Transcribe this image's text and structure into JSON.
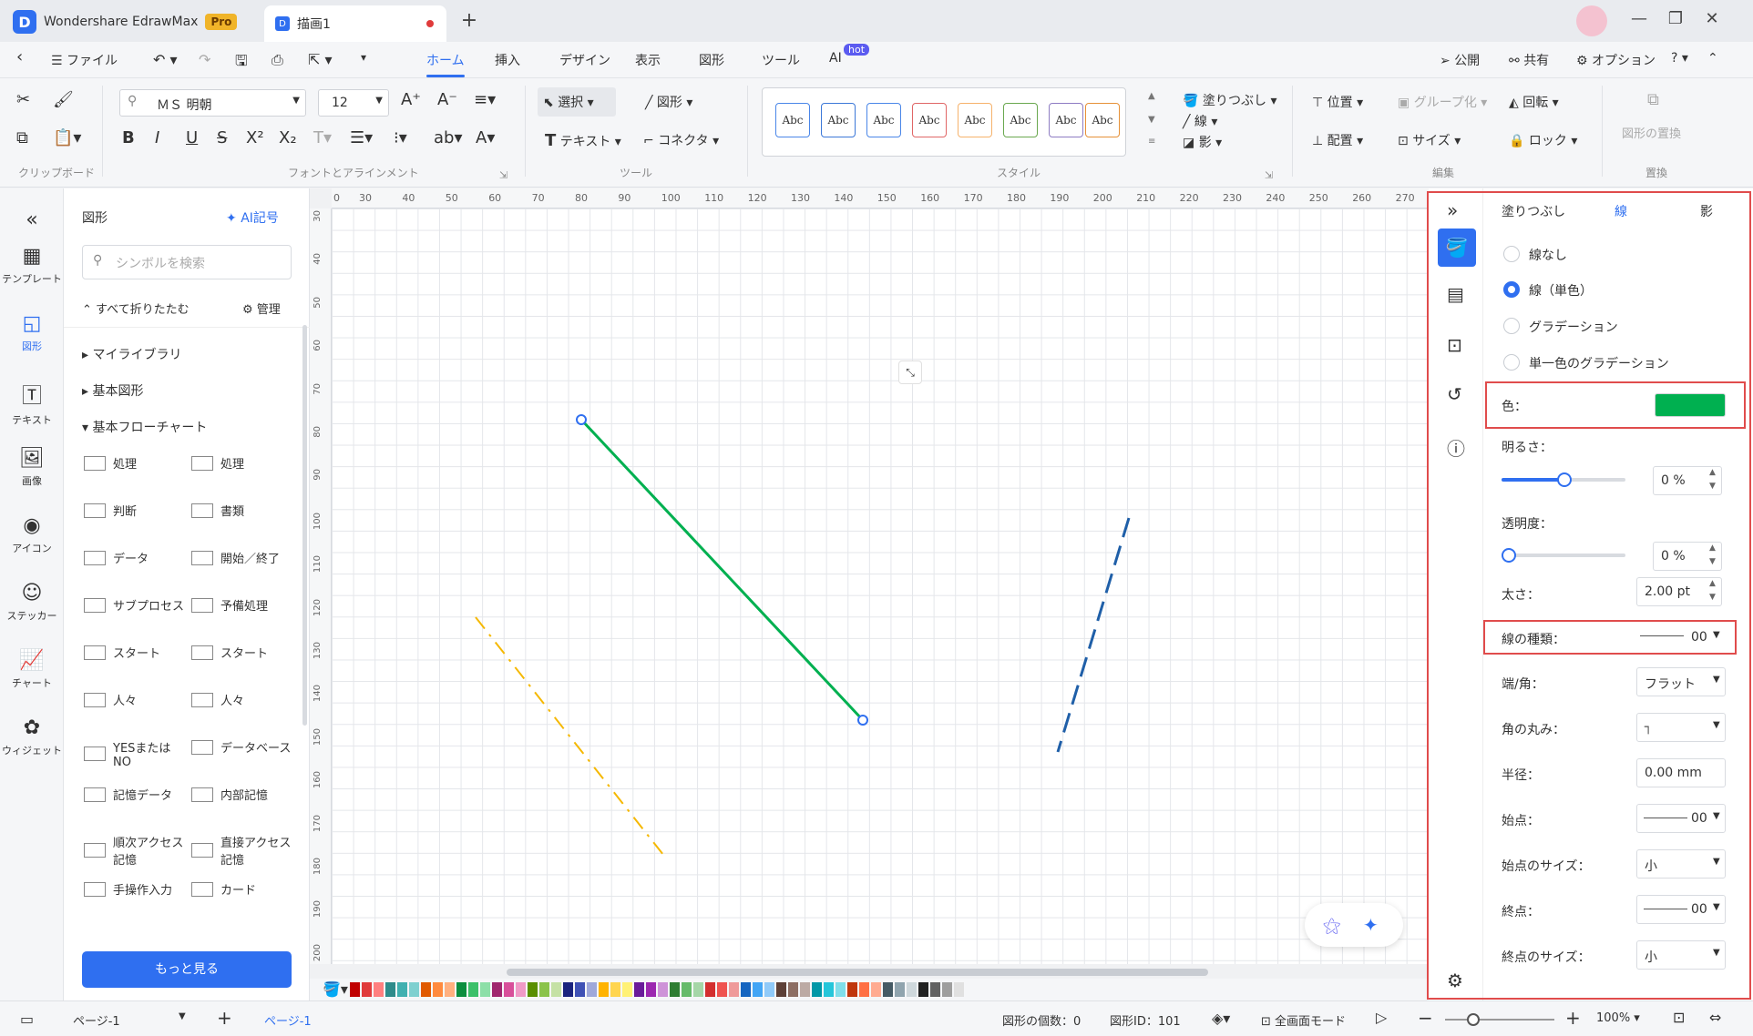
{
  "app": {
    "name": "Wondershare EdrawMax",
    "badge": "Pro",
    "doc_tab": "描画1"
  },
  "menu": {
    "file": "ファイル",
    "tabs": [
      "ホーム",
      "挿入",
      "デザイン",
      "表示",
      "図形",
      "ツール",
      "AI"
    ],
    "ai_badge": "hot",
    "publish": "公開",
    "share": "共有",
    "options": "オプション"
  },
  "ribbon": {
    "font_name": "ＭＳ 明朝",
    "font_size": "12",
    "select": "選択",
    "shape": "図形",
    "text": "テキスト",
    "connector": "コネクタ",
    "fill": "塗りつぶし",
    "line": "線",
    "shadow": "影",
    "position": "位置",
    "group": "グループ化",
    "rotate": "回転",
    "align": "配置",
    "size": "サイズ",
    "lock": "ロック",
    "replace_shape": "図形の置換",
    "abc": "Abc",
    "groups": {
      "clipboard": "クリップボード",
      "font": "フォントとアラインメント",
      "tool": "ツール",
      "style": "スタイル",
      "edit": "編集",
      "replace": "置換"
    }
  },
  "left_rail": [
    "テンプレート",
    "図形",
    "テキスト",
    "画像",
    "アイコン",
    "ステッカー",
    "チャート",
    "ウィジェット"
  ],
  "shape_panel": {
    "title": "図形",
    "ai_symbol": "AI記号",
    "search_placeholder": "シンボルを検索",
    "collapse_all": "すべて折りたたむ",
    "manage": "管理",
    "sections": [
      "マイライブラリ",
      "基本図形",
      "基本フローチャート"
    ],
    "shapes": [
      [
        "処理",
        "処理"
      ],
      [
        "判断",
        "書類"
      ],
      [
        "データ",
        "開始／終了"
      ],
      [
        "サブプロセス",
        "予備処理"
      ],
      [
        "スタート",
        "スタート"
      ],
      [
        "人々",
        "人々"
      ],
      [
        "YESまたは NO",
        "データベース"
      ],
      [
        "記憶データ",
        "内部記憶"
      ],
      [
        "順次アクセス 記憶",
        "直接アクセス 記憶"
      ],
      [
        "手操作入力",
        "カード"
      ]
    ],
    "more": "もっと見る"
  },
  "ruler": {
    "h": [
      "0",
      "30",
      "40",
      "50",
      "60",
      "70",
      "80",
      "90",
      "100",
      "110",
      "120",
      "130",
      "140",
      "150",
      "160",
      "170",
      "180",
      "190",
      "200",
      "210",
      "220",
      "230",
      "240",
      "250",
      "260",
      "270"
    ],
    "v": [
      "30",
      "40",
      "50",
      "60",
      "70",
      "80",
      "90",
      "100",
      "110",
      "120",
      "130",
      "140",
      "150",
      "160",
      "170",
      "180",
      "190",
      "200"
    ]
  },
  "right_panel": {
    "tabs": [
      "塗りつぶし",
      "線",
      "影"
    ],
    "radios": [
      "線なし",
      "線（単色）",
      "グラデーション",
      "単一色のグラデーション"
    ],
    "color_label": "色：",
    "color_value": "#00b050",
    "brightness_label": "明るさ：",
    "brightness_value": "0 %",
    "transparency_label": "透明度：",
    "transparency_value": "0 %",
    "width_label": "太さ：",
    "width_value": "2.00 pt",
    "line_type_label": "線の種類：",
    "line_type_value": "00",
    "cap_label": "端/角：",
    "cap_value": "フラット",
    "round_label": "角の丸み：",
    "radius_label": "半径：",
    "radius_value": "0.00 mm",
    "start_label": "始点：",
    "start_value": "00",
    "start_size_label": "始点のサイズ：",
    "start_size_value": "小",
    "end_label": "終点：",
    "end_value": "00",
    "end_size_label": "終点のサイズ：",
    "end_size_value": "小"
  },
  "status": {
    "page_sel": "ページ-1",
    "page_tab": "ページ-1",
    "shape_count": "図形の個数：0",
    "shape_id": "図形ID：101",
    "fullscreen": "全画面モード",
    "zoom": "100%"
  },
  "colors": {
    "accent": "#2f6ff0",
    "green_line": "#00b050",
    "yellow_line": "#f5b800",
    "blue_line": "#1f5fa8"
  }
}
